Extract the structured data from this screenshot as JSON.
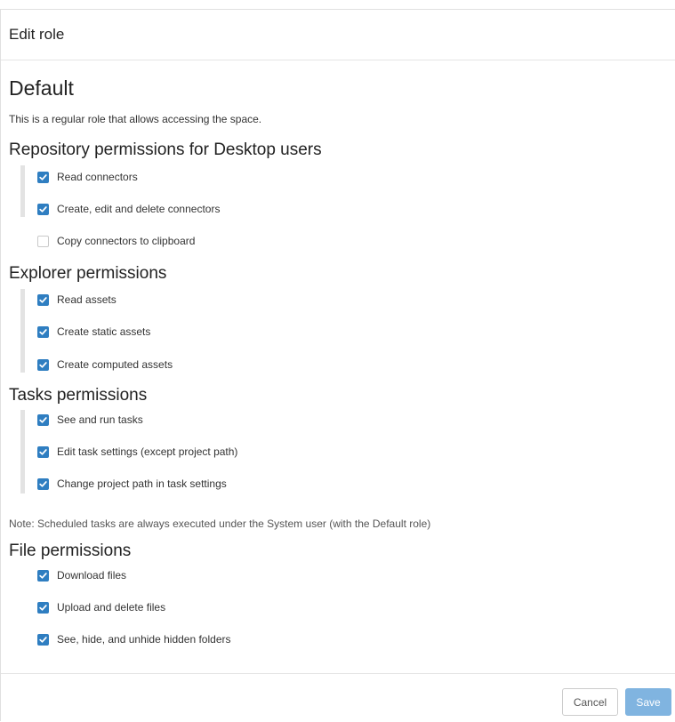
{
  "dialog": {
    "title": "Edit role",
    "role_name": "Default",
    "role_description": "This is a regular role that allows accessing the space.",
    "sections": [
      {
        "title": "Repository permissions for Desktop users",
        "permissions": [
          {
            "label": "Read connectors",
            "checked": true
          },
          {
            "label": "Create, edit and delete connectors",
            "checked": true
          },
          {
            "label": "Copy connectors to clipboard",
            "checked": false
          }
        ]
      },
      {
        "title": "Explorer permissions",
        "permissions": [
          {
            "label": "Read assets",
            "checked": true
          },
          {
            "label": "Create static assets",
            "checked": true
          },
          {
            "label": "Create computed assets",
            "checked": true
          }
        ]
      },
      {
        "title": "Tasks permissions",
        "permissions": [
          {
            "label": "See and run tasks",
            "checked": true
          },
          {
            "label": "Edit task settings (except project path)",
            "checked": true
          },
          {
            "label": "Change project path in task settings",
            "checked": true
          }
        ]
      },
      {
        "title": "File permissions",
        "permissions": [
          {
            "label": "Download files",
            "checked": true
          },
          {
            "label": "Upload and delete files",
            "checked": true
          },
          {
            "label": "See, hide, and unhide hidden folders",
            "checked": true
          }
        ]
      }
    ],
    "note": "Note: Scheduled tasks are always executed under the System user (with the Default role)",
    "buttons": {
      "cancel": "Cancel",
      "save": "Save"
    }
  },
  "colors": {
    "accent": "#2f7ec1",
    "save_button": "#80b4e0"
  },
  "icons": {
    "checked": "checkmark-icon"
  }
}
